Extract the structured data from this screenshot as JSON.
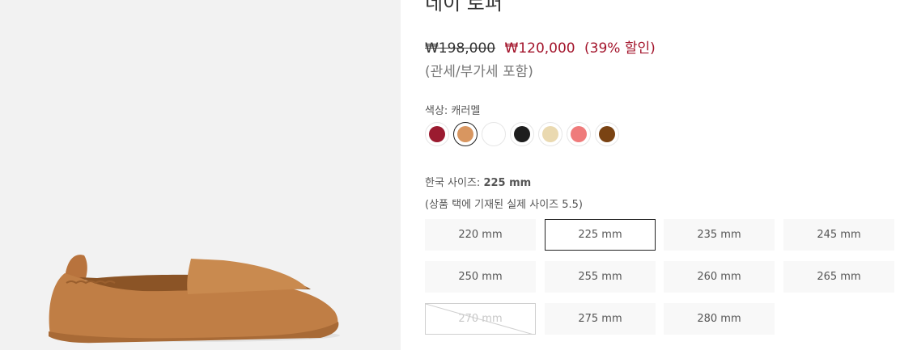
{
  "product": {
    "title": "네이 로퍼",
    "price_original": "₩198,000",
    "price_sale": "₩120,000",
    "discount": "(39% 할인)",
    "tax_note": "(관세/부가세 포함)"
  },
  "color": {
    "label": "색상: 캐러멜",
    "swatches": [
      {
        "name": "burgundy",
        "hex": "#9b1b30"
      },
      {
        "name": "caramel",
        "hex": "#d89660",
        "selected": true
      },
      {
        "name": "white",
        "hex": "#ffffff"
      },
      {
        "name": "black",
        "hex": "#1e1e1e"
      },
      {
        "name": "cream",
        "hex": "#ead9b0"
      },
      {
        "name": "pink",
        "hex": "#ef7b7b"
      },
      {
        "name": "brown",
        "hex": "#7a4313"
      }
    ]
  },
  "size": {
    "label_prefix": "한국 사이즈:",
    "label_value": "225 mm",
    "note": "(상품 택에 기재된 실제 사이즈 5.5)",
    "options": [
      {
        "label": "220 mm"
      },
      {
        "label": "225 mm",
        "selected": true
      },
      {
        "label": "235 mm"
      },
      {
        "label": "245 mm"
      },
      {
        "label": "250 mm"
      },
      {
        "label": "255 mm"
      },
      {
        "label": "260 mm"
      },
      {
        "label": "265 mm"
      },
      {
        "label": "270 mm",
        "sold_out": true
      },
      {
        "label": "275 mm"
      },
      {
        "label": "280 mm"
      }
    ]
  },
  "image": {
    "alt": "caramel leather loafer"
  }
}
